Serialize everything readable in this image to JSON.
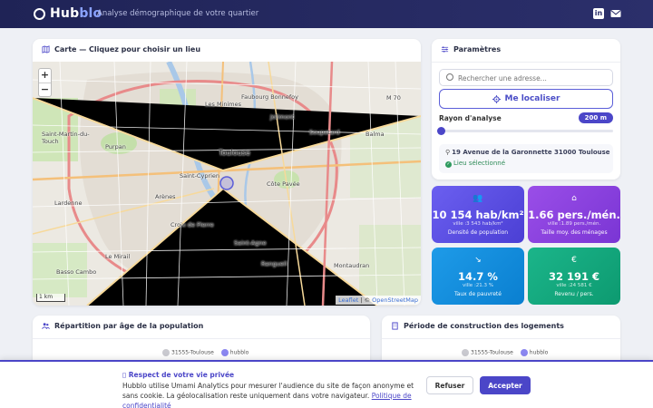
{
  "header": {
    "logo_main": "Hub",
    "logo_accent": "blo",
    "tagline": "Analyse démographique de votre quartier",
    "linkedin_icon": "linkedin-icon",
    "mail_icon": "mail-icon"
  },
  "map": {
    "title": "Carte — Cliquez pour choisir un lieu",
    "zoom_in": "+",
    "zoom_out": "−",
    "scale": "1 km",
    "attribution_leaflet": "Leaflet",
    "attribution_sep": " | © ",
    "attribution_osm": "OpenStreetMap",
    "labels": {
      "toulouse": "Toulouse",
      "faubourg": "Faubourg Bonnefoy",
      "jolimont": "Jolimont",
      "soupetard": "Soupetard",
      "balma": "Balma",
      "minimes": "Les Minimes",
      "martin": "Saint-Martin-du-Touch",
      "purpan": "Purpan",
      "cyprien": "Saint-Cyprien",
      "arenes": "Arènes",
      "lardenne": "Lardenne",
      "pavee": "Côte Pavée",
      "croix": "Croix de Pierre",
      "agne": "Saint-Agne",
      "mirail": "Le Mirail",
      "rangueil": "Rangueil",
      "basso": "Basso Cambo",
      "montaudran": "Montaudran",
      "m70": "M 70"
    }
  },
  "params": {
    "title": "Paramètres",
    "search_placeholder": "Rechercher une adresse...",
    "locate_label": "Me localiser",
    "radius_label": "Rayon d'analyse",
    "radius_value": "200 m",
    "address": "19 Avenue de la Garonnette 31000 Toulouse",
    "selected": "Lieu sélectionné"
  },
  "stats": [
    {
      "value": "10 154 hab/km²",
      "ville": "ville :3 543 hab/km²",
      "label": "Densité de population",
      "icon": "people-icon"
    },
    {
      "value": "1.66 pers./mén.",
      "ville": "ville :1.89 pers./mén.",
      "label": "Taille moy. des ménages",
      "icon": "house-icon"
    },
    {
      "value": "14.7 %",
      "ville": "ville :21.3 %",
      "label": "Taux de pauvreté",
      "icon": "trend-down-icon"
    },
    {
      "value": "32 191 €",
      "ville": "ville :24 581 €",
      "label": "Revenu / pers.",
      "icon": "money-icon"
    }
  ],
  "age_chart": {
    "title": "Répartition par âge de la population",
    "legend": [
      "31555-Toulouse",
      "hubblo"
    ],
    "colors": [
      "#c9c9cf",
      "#8a86f0"
    ]
  },
  "cons_chart": {
    "title": "Période de construction des logements",
    "legend": [
      "31555-Toulouse",
      "hubblo"
    ]
  },
  "cookie": {
    "title": "Respect de votre vie privée",
    "text": "Hubblo utilise Umami Analytics pour mesurer l'audience du site de façon anonyme et sans cookie. La géolocalisation reste uniquement dans votre navigateur. ",
    "link": "Politique de confidentialité",
    "refuse": "Refuser",
    "accept": "Accepter"
  },
  "colors": {
    "brand": "#4b46c8",
    "header": "#2b2f6b"
  }
}
